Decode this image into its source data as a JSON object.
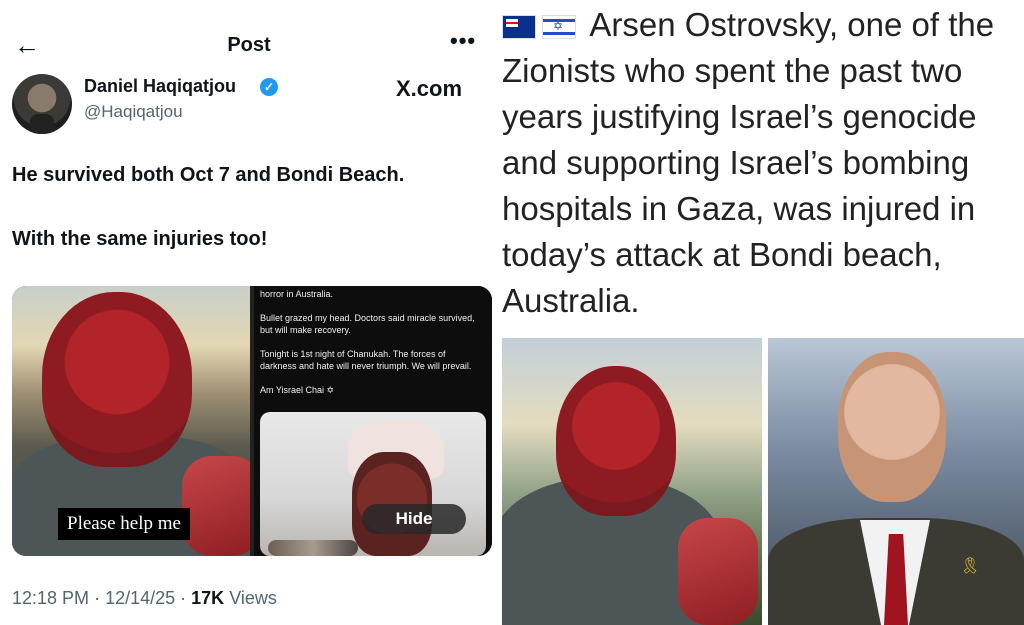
{
  "left_post": {
    "header": {
      "back_icon": "←",
      "title": "Post",
      "more_icon": "•••"
    },
    "author": {
      "name": "Daniel Haqiqatjou",
      "handle": "@Haqiqatjou",
      "verified_icon": "✓"
    },
    "source_label": "X.com",
    "text_lines": [
      "He survived both Oct 7 and Bondi Beach.",
      "With the same injuries too!"
    ],
    "media": {
      "left_caption": "Please help me",
      "screenshot_text": [
        "horror in Australia.",
        "Bullet grazed my head. Doctors said miracle survived, but will make recovery.",
        "Tonight is 1st night of Chanukah. The forces of darkness and hate will never triumph. We will prevail.",
        "Am Yisrael Chai ✡"
      ],
      "hide_label": "Hide"
    },
    "meta": {
      "time": "12:18 PM",
      "date": "12/14/25",
      "views_count": "17K",
      "views_label": "Views"
    }
  },
  "right_post": {
    "text": "Arsen Ostrovsky, one of the Zionists who spent the past two years justifying Israel’s genocide and supporting Israel’s bombing hospitals in Gaza, was injured in today’s attack at Bondi beach, Australia."
  }
}
